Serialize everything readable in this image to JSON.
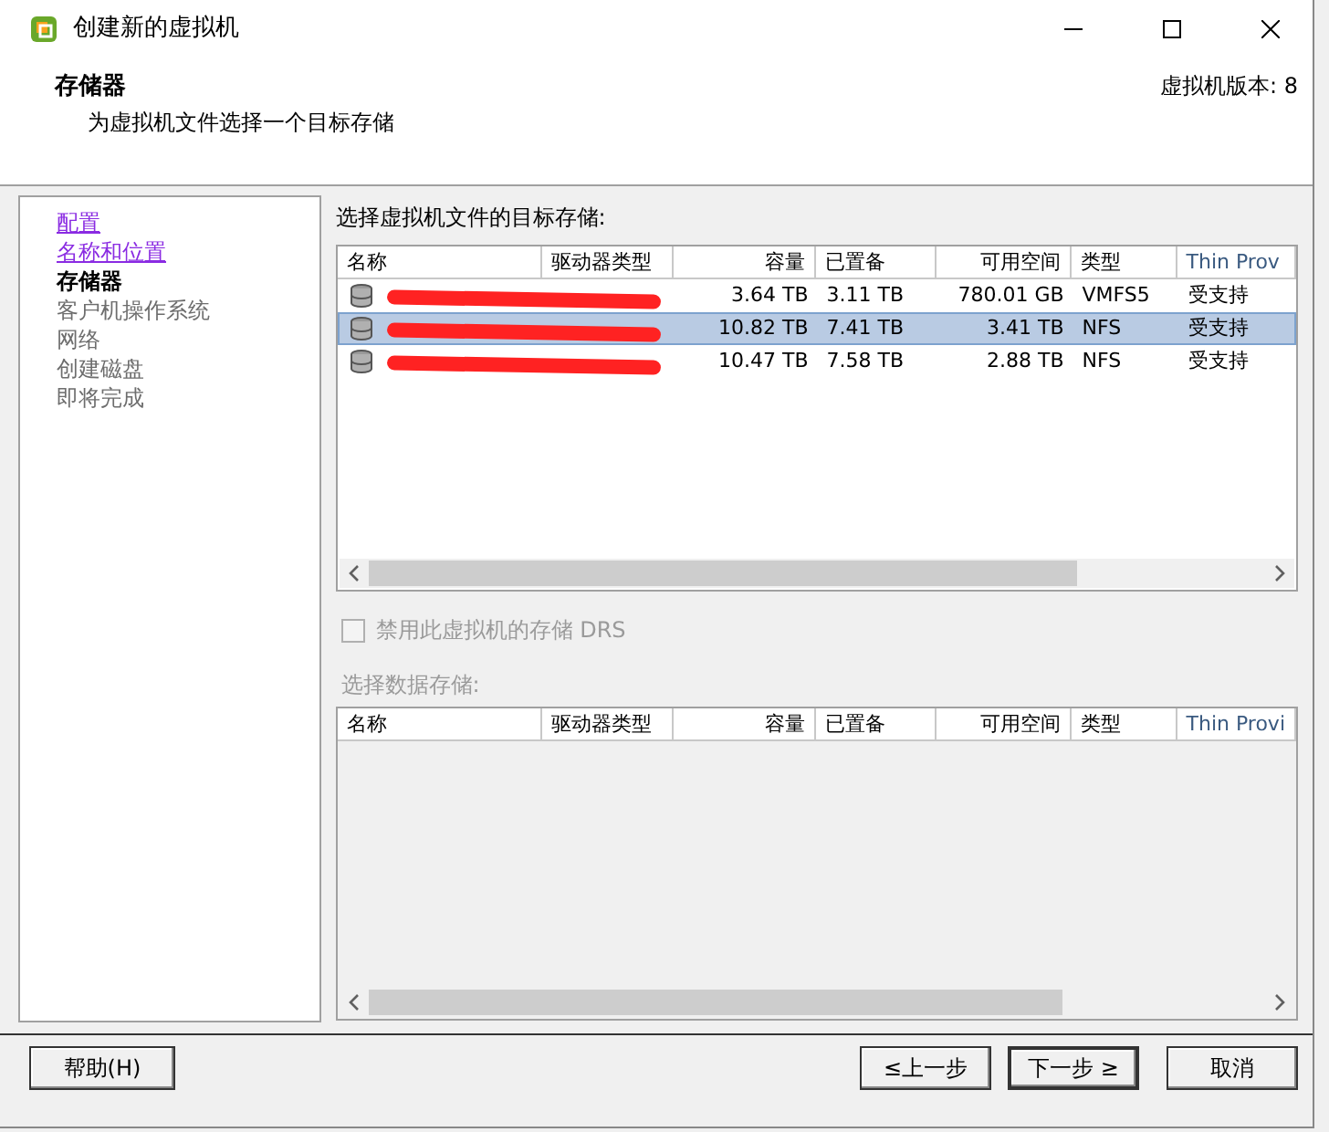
{
  "window": {
    "title": "创建新的虚拟机"
  },
  "header": {
    "title": "存储器",
    "subtitle": "为虚拟机文件选择一个目标存储",
    "version": "虚拟机版本: 8"
  },
  "steps": [
    {
      "label": "配置",
      "visited": true,
      "current": false
    },
    {
      "label": "名称和位置",
      "visited": true,
      "current": false
    },
    {
      "label": "存储器",
      "visited": false,
      "current": true
    },
    {
      "label": "客户机操作系统",
      "visited": false,
      "current": false
    },
    {
      "label": "网络",
      "visited": false,
      "current": false
    },
    {
      "label": "创建磁盘",
      "visited": false,
      "current": false
    },
    {
      "label": "即将完成",
      "visited": false,
      "current": false
    }
  ],
  "target_label": "选择虚拟机文件的目标存储:",
  "table": {
    "columns": [
      "名称",
      "驱动器类型",
      "容量",
      "已置备",
      "可用空间",
      "类型",
      "Thin Prov"
    ],
    "rows": [
      {
        "redacted": true,
        "selected": false,
        "capacity": "3.64 TB",
        "provisioned": "3.11 TB",
        "free": "780.01 GB",
        "type": "VMFS5",
        "thin": "受支持"
      },
      {
        "redacted": true,
        "selected": true,
        "capacity": "10.82 TB",
        "provisioned": "7.41 TB",
        "free": "3.41 TB",
        "type": "NFS",
        "thin": "受支持"
      },
      {
        "redacted": true,
        "selected": false,
        "capacity": "10.47 TB",
        "provisioned": "7.58 TB",
        "free": "2.88 TB",
        "type": "NFS",
        "thin": "受支持"
      }
    ]
  },
  "drs_checkbox": {
    "label": "禁用此虚拟机的存储 DRS",
    "checked": false,
    "disabled": true
  },
  "datastore_label": {
    "text": "选择数据存储:",
    "disabled": true
  },
  "datastore_table": {
    "columns": [
      "名称",
      "驱动器类型",
      "容量",
      "已置备",
      "可用空间",
      "类型",
      "Thin Provi"
    ]
  },
  "buttons": {
    "help": "帮助(H)",
    "back": "≤上一步",
    "next": "下一步 ≥",
    "cancel": "取消"
  }
}
